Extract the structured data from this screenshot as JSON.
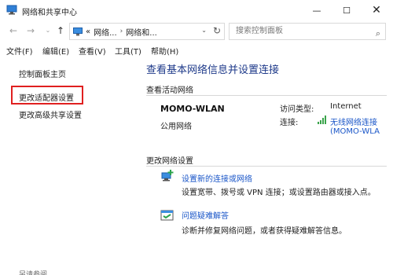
{
  "window": {
    "title": "网络和共享中心"
  },
  "controls": {
    "minimize": "—",
    "maximize": "☐",
    "close": "✕"
  },
  "address": {
    "recent_chevron": "⌄",
    "overflow": "«",
    "crumb1": "网络...",
    "sep": "›",
    "crumb2": "网络和...",
    "dropdown": "⌄",
    "refresh": "↻"
  },
  "search": {
    "placeholder": "搜索控制面板",
    "icon": "⌕"
  },
  "menu": {
    "file": "文件(F)",
    "edit": "编辑(E)",
    "view": "查看(V)",
    "tools": "工具(T)",
    "help": "帮助(H)"
  },
  "sidebar": {
    "home": "控制面板主页",
    "adapter": "更改适配器设置",
    "advanced": "更改高级共享设置",
    "see_also": "另请参阅"
  },
  "main": {
    "title": "查看基本网络信息并设置连接",
    "active_networks_label": "查看活动网络",
    "network_name": "MOMO-WLAN",
    "network_type": "公用网络",
    "access_type_label": "访问类型:",
    "access_type_value": "Internet",
    "connections_label": "连接:",
    "connection_link_line1": "无线网络连接",
    "connection_link_line2": "(MOMO-WLA",
    "change_settings_label": "更改网络设置",
    "tasks": [
      {
        "link": "设置新的连接或网络",
        "desc": "设置宽带、拨号或 VPN 连接；或设置路由器或接入点。"
      },
      {
        "link": "问题疑难解答",
        "desc": "诊断并修复网络问题，或者获得疑难解答信息。"
      }
    ]
  },
  "colors": {
    "link": "#1a56c8",
    "title": "#1e3a8a",
    "highlight": "#e02020"
  }
}
